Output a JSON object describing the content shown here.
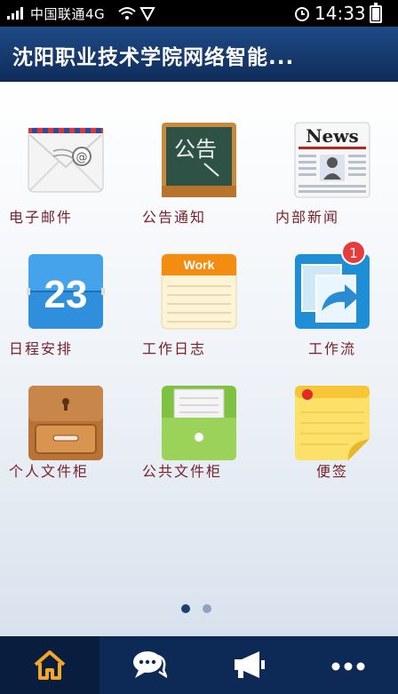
{
  "status_bar": {
    "carrier": "中国联通4G",
    "time": "14:33"
  },
  "header": {
    "title": "沈阳职业技术学院网络智能..."
  },
  "apps": [
    {
      "label": "电子邮件",
      "icon": "email-icon"
    },
    {
      "label": "公告通知",
      "icon": "notice-board-icon",
      "icon_text": "公告"
    },
    {
      "label": "内部新闻",
      "icon": "newspaper-icon",
      "icon_text": "News"
    },
    {
      "label": "日程安排",
      "icon": "calendar-icon",
      "icon_text": "23"
    },
    {
      "label": "工作日志",
      "icon": "notepad-icon",
      "icon_text": "Work"
    },
    {
      "label": "工作流",
      "icon": "workflow-icon",
      "badge": "1"
    },
    {
      "label": "个人文件柜",
      "icon": "personal-cabinet-icon"
    },
    {
      "label": "公共文件柜",
      "icon": "public-cabinet-icon"
    },
    {
      "label": "便签",
      "icon": "sticky-note-icon"
    }
  ],
  "pager": {
    "current": 1,
    "total": 2
  },
  "tabbar": {
    "items": [
      {
        "icon": "home-icon",
        "active": true
      },
      {
        "icon": "chat-icon",
        "active": false
      },
      {
        "icon": "megaphone-icon",
        "active": false
      },
      {
        "icon": "more-icon",
        "active": false
      }
    ]
  },
  "colors": {
    "header": "#1a3f78",
    "label": "#7a1f2a",
    "badge": "#e63c3c",
    "tabbar": "#0d2a57",
    "home_accent": "#f5a623"
  }
}
